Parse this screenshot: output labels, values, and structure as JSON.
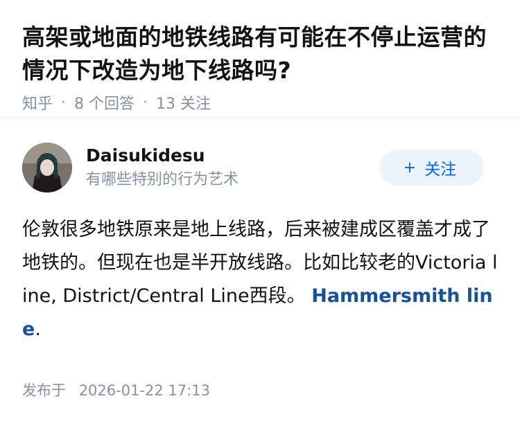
{
  "question": {
    "title": "高架或地面的地铁线路有可能在不停止运营的情况下改造为地下线路吗?",
    "site": "知乎",
    "separator": "·",
    "answers_count": "8 个回答",
    "followers_count": "13 关注"
  },
  "answer": {
    "author": {
      "name": "Daisukidesu",
      "bio": "有哪些特别的行为艺术",
      "avatar_icon": "avatar-photo"
    },
    "follow_button": {
      "plus": "+",
      "label": "关注"
    },
    "body": {
      "text": "伦敦很多地铁原来是地上线路，后来被建成区覆盖才成了地铁的。但现在也是半开放线路。比如比较老的Victoria line, District/Central Line西段。 ",
      "link": "Hammersmith line",
      "tail": "."
    },
    "published": {
      "label": "发布于",
      "datetime": "2026-01-22 17:13"
    }
  },
  "colors": {
    "link": "#175199",
    "meta": "#8590a6",
    "follow_bg": "#ebf3fb",
    "follow_text": "#0066ff"
  }
}
